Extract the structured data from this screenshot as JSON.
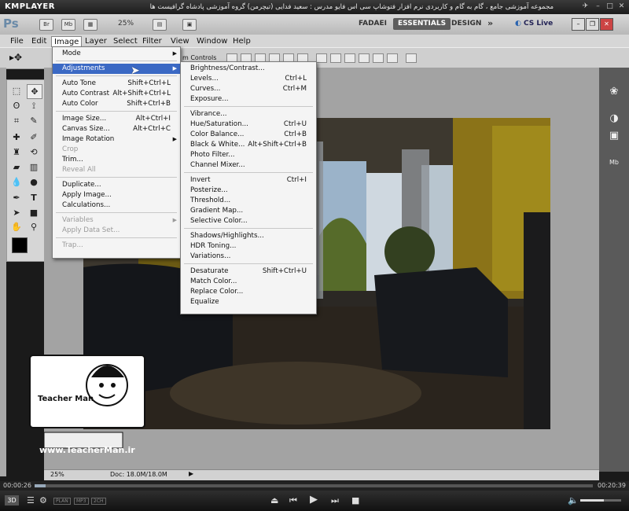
{
  "player": {
    "logo": "KMPLAYER",
    "caption": "مجموعه آموزشی جامع ، گام به گام و کاربردی نرم افزار فتوشاپ سی اس فایو  مدرس : سعید فدایی (تیچرمن) گروه آموزشی پادشاه گرافیست ها",
    "time_elapsed": "00:00:26",
    "time_total": "00:20:39",
    "progress": 0.02,
    "badges": [
      "3D",
      "PLAN",
      "MP3",
      "2CH"
    ]
  },
  "appbar": {
    "logo": "Ps",
    "br_label": "Br",
    "mb_label": "Mb",
    "zoom": "25%",
    "workspaces": [
      "FADAEI",
      "ESSENTIALS",
      "DESIGN"
    ],
    "active_workspace": "ESSENTIALS",
    "cs_live": "CS Live"
  },
  "menubar": [
    "File",
    "Edit",
    "Image",
    "Layer",
    "Select",
    "Filter",
    "View",
    "Window",
    "Help"
  ],
  "options_bar": {
    "transform_label": "m Controls"
  },
  "image_menu": [
    {
      "label": "Mode",
      "shortcut": "",
      "submenu": true,
      "disabled": false
    },
    {
      "sep": true
    },
    {
      "label": "Adjustments",
      "shortcut": "",
      "submenu": true,
      "disabled": false,
      "highlighted": true
    },
    {
      "sep": true
    },
    {
      "label": "Auto Tone",
      "shortcut": "Shift+Ctrl+L"
    },
    {
      "label": "Auto Contrast",
      "shortcut": "Alt+Shift+Ctrl+L"
    },
    {
      "label": "Auto Color",
      "shortcut": "Shift+Ctrl+B"
    },
    {
      "sep": true
    },
    {
      "label": "Image Size...",
      "shortcut": "Alt+Ctrl+I"
    },
    {
      "label": "Canvas Size...",
      "shortcut": "Alt+Ctrl+C"
    },
    {
      "label": "Image Rotation",
      "shortcut": "",
      "submenu": true
    },
    {
      "label": "Crop",
      "shortcut": "",
      "disabled": true
    },
    {
      "label": "Trim...",
      "shortcut": ""
    },
    {
      "label": "Reveal All",
      "shortcut": "",
      "disabled": true
    },
    {
      "sep": true
    },
    {
      "label": "Duplicate...",
      "shortcut": ""
    },
    {
      "label": "Apply Image...",
      "shortcut": ""
    },
    {
      "label": "Calculations...",
      "shortcut": ""
    },
    {
      "sep": true
    },
    {
      "label": "Variables",
      "shortcut": "",
      "submenu": true,
      "disabled": true
    },
    {
      "label": "Apply Data Set...",
      "shortcut": "",
      "disabled": true
    },
    {
      "sep": true
    },
    {
      "label": "Trap...",
      "shortcut": "",
      "disabled": true
    }
  ],
  "adjust_menu": [
    {
      "label": "Brightness/Contrast...",
      "shortcut": ""
    },
    {
      "label": "Levels...",
      "shortcut": "Ctrl+L"
    },
    {
      "label": "Curves...",
      "shortcut": "Ctrl+M"
    },
    {
      "label": "Exposure...",
      "shortcut": ""
    },
    {
      "sep": true
    },
    {
      "label": "Vibrance...",
      "shortcut": ""
    },
    {
      "label": "Hue/Saturation...",
      "shortcut": "Ctrl+U"
    },
    {
      "label": "Color Balance...",
      "shortcut": "Ctrl+B"
    },
    {
      "label": "Black & White...",
      "shortcut": "Alt+Shift+Ctrl+B"
    },
    {
      "label": "Photo Filter...",
      "shortcut": ""
    },
    {
      "label": "Channel Mixer...",
      "shortcut": ""
    },
    {
      "sep": true
    },
    {
      "label": "Invert",
      "shortcut": "Ctrl+I"
    },
    {
      "label": "Posterize...",
      "shortcut": ""
    },
    {
      "label": "Threshold...",
      "shortcut": ""
    },
    {
      "label": "Gradient Map...",
      "shortcut": ""
    },
    {
      "label": "Selective Color...",
      "shortcut": ""
    },
    {
      "sep": true
    },
    {
      "label": "Shadows/Highlights...",
      "shortcut": ""
    },
    {
      "label": "HDR Toning...",
      "shortcut": ""
    },
    {
      "label": "Variations...",
      "shortcut": ""
    },
    {
      "sep": true
    },
    {
      "label": "Desaturate",
      "shortcut": "Shift+Ctrl+U"
    },
    {
      "label": "Match Color...",
      "shortcut": ""
    },
    {
      "label": "Replace Color...",
      "shortcut": ""
    },
    {
      "label": "Equalize",
      "shortcut": ""
    }
  ],
  "status": {
    "zoom": "25%",
    "doc": "Doc: 18.0M/18.0M"
  },
  "watermark": {
    "site": "www.TeacherMan.ir",
    "brand": "Teacher Man"
  },
  "colors": {
    "highlight": "#3b69c4",
    "menu_bg": "#f4f4f4",
    "canvas_bg": "#a3a3a3"
  }
}
